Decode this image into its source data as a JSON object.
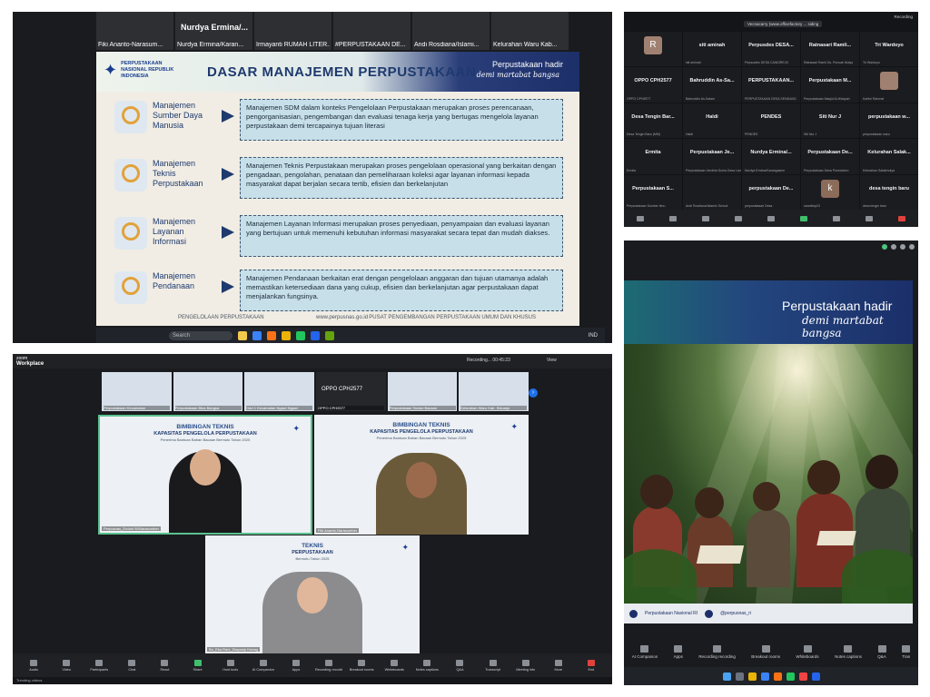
{
  "panel_a": {
    "thumbs": [
      {
        "name": "Fiki Ananto-Narasum...",
        "big": ""
      },
      {
        "name": "Nurdya Ermina/Karan...",
        "big": "Nurdya Ermina/..."
      },
      {
        "name": "Irmayanti RUMAH LITER...",
        "big": ""
      },
      {
        "name": "#PERPUSTAKAAN DE...",
        "big": ""
      },
      {
        "name": "Andi Rosdiana/Islami...",
        "big": ""
      },
      {
        "name": "Kelurahan Waru Kab...",
        "big": ""
      }
    ],
    "slide": {
      "logo_text": "PERPUSTAKAAN NASIONAL REPUBLIK INDONESIA",
      "title": "DASAR MANAJEMEN PERPUSTAKAAN",
      "tagline": "Perpustakaan hadir",
      "tagline2": "demi martabat bangsa",
      "rows": [
        {
          "label": "Manajemen Sumber Daya Manusia",
          "text": "Manajemen SDM dalam konteks Pengelolaan Perpustakaan merupakan proses perencanaan, pengorganisasian, pengembangan dan evaluasi tenaga kerja yang bertugas mengelola layanan perpustakaan demi tercapainya tujuan literasi"
        },
        {
          "label": "Manajemen Teknis Perpustakaan",
          "text": "Manajemen Teknis Perpustakaan merupakan proses pengelolaan operasional yang berkaitan dengan pengadaan, pengolahan, penataan dan pemeliharaan koleksi agar layanan informasi kepada masyarakat dapat berjalan secara tertib, efisien dan berkelanjutan"
        },
        {
          "label": "Manajemen Layanan Informasi",
          "text": "Manajemen Layanan Informasi merupakan proses penyediaan, penyampaian dan evaluasi layanan yang bertujuan untuk memenuhi kebutuhan informasi masyarakat secara tepat dan mudah diakses."
        },
        {
          "label": "Manajemen Pendanaan",
          "text": "Manajemen Pendanaan berkaitan erat dengan pengelolaan anggaran dan tujuan utamanya adalah memastikan ketersediaan dana yang cukup, efisien dan berkelanjutan agar perpustakaan dapat menjalankan fungsinya."
        }
      ],
      "footer_left": "PENGELOLAAN PERPUSTAKAAN",
      "footer_mid": "www.perpusnas.go.id",
      "footer_right": "PUSAT PENGEMBANGAN PERPUSTAKAAN UMUM DAN KHUSUS"
    },
    "taskbar": {
      "search": "Search",
      "tray": "IND"
    }
  },
  "panel_b": {
    "tooltip": "Vecnacarry (www.officefactory ... siding",
    "rec": "Recording",
    "cells": [
      {
        "name": "",
        "sub": "",
        "avatar": "R"
      },
      {
        "name": "siti aminah",
        "sub": "siti aminah"
      },
      {
        "name": "Perpusdes DESA...",
        "sub": "Perpusdes DESA CANDIREJO"
      },
      {
        "name": "Ratnasari Ramli...",
        "sub": "Ratnasari Ramli Ds. Puncak Mulya"
      },
      {
        "name": "Tri Wardoyo",
        "sub": "Tri Wardoyo"
      },
      {
        "name": "OPPO CPH2577",
        "sub": "OPPO CPH2577"
      },
      {
        "name": "Bahruddin As-Sa...",
        "sub": "Bahruddin As-Salam"
      },
      {
        "name": "PERPUSTAKAAN...",
        "sub": "PERPUSTAKAAN DESA SENDANG"
      },
      {
        "name": "Perpustakaan M...",
        "sub": "Perpustakaan Masjid Al-Hidayah"
      },
      {
        "name": "",
        "sub": "Kartini Rahmat",
        "avatar": ""
      },
      {
        "name": "Desa Tengin Bar...",
        "sub": "Desa Tengin Baru (MM)"
      },
      {
        "name": "Haldi",
        "sub": "Haldi"
      },
      {
        "name": "PENDES",
        "sub": "PENDES"
      },
      {
        "name": "Siti Nur J",
        "sub": "Siti Nur J"
      },
      {
        "name": "perpustakaan w...",
        "sub": "perpustakaan waru"
      },
      {
        "name": "Ermita",
        "sub": "Ermita"
      },
      {
        "name": "Perpustakaan Je...",
        "sub": "Perpustakaan Jendela Dunia Desa Lampon"
      },
      {
        "name": "Nurdya Ermina/...",
        "sub": "Nurdya Ermina/Karangasem"
      },
      {
        "name": "Perpustakaan De...",
        "sub": "Perpustakaan Desa Purwotomo"
      },
      {
        "name": "Kelurahan Salak...",
        "sub": "Kelurahan Salakmulya"
      },
      {
        "name": "Perpustakaan S...",
        "sub": "Perpustakaan Sumber Ilmu"
      },
      {
        "name": "",
        "sub": "Andi Rosdiana/Islamic School"
      },
      {
        "name": "perpustakaan De...",
        "sub": "perpustakaan Desa"
      },
      {
        "name": "",
        "sub": "sandelay03",
        "avatar": "k"
      },
      {
        "name": "desa tengin baru",
        "sub": "desa tengin baru"
      }
    ],
    "search": "Search"
  },
  "panel_c": {
    "app_sub": "zoom",
    "app_name": "Workplace",
    "recording": "Recording...",
    "time": "00:45:23",
    "view": "View",
    "strip": [
      {
        "name": "Perpustakaan Kecamatan",
        "big": "",
        "dark": false
      },
      {
        "name": "Perpustakaan Bina Bangsa",
        "big": "",
        "dark": false
      },
      {
        "name": "Hari 1 Kecamatan Ngawi Ngawi",
        "big": "",
        "dark": false
      },
      {
        "name": "OPPO CPH2577",
        "big": "OPPO CPH2577",
        "dark": true
      },
      {
        "name": "Perpustakaan Taman Bacaan",
        "big": "",
        "dark": false
      },
      {
        "name": "Kelurahan Waru Kab. Sidoarjo",
        "big": "",
        "dark": false
      }
    ],
    "tiles": [
      {
        "t1": "BIMBINGAN TEKNIS",
        "t2": "KAPASITAS PENGELOLA PERPUSTAKAAN",
        "t3": "Penerima Bantuan Bahan Bacaan Bermutu Tahun 2025",
        "name": "Perpusnas_Endah W/Narasumber"
      },
      {
        "t1": "BIMBINGAN TEKNIS",
        "t2": "KAPASITAS PENGELOLA PERPUSTAKAAN",
        "t3": "Penerima Bantuan Bahan Bacaan Bermutu Tahun 2025",
        "name": "Fiki Ananto-Narasumber"
      },
      {
        "t1": "TEKNIS",
        "t2": "PERPUSTAKAAN",
        "t3": "Bermutu Tahun 2025",
        "name": "Bu_Eka Rani_Diapusip Kenag"
      }
    ],
    "toolbar": [
      "Audio",
      "Video",
      "Participants",
      "Chat",
      "React",
      "Share",
      "Host tools",
      "AI Companion",
      "Apps",
      "Recording recording",
      "Breakout rooms",
      "Whiteboards",
      "Notes captions",
      "Q&A",
      "Transcript",
      "Meeting info",
      "More",
      "End"
    ],
    "winbar": "Trending videos"
  },
  "panel_d": {
    "banner_line1": "Perpustakaan hadir",
    "banner_line2": "demi martabat bangsa",
    "social1": "Perpustakaan Nasional RI",
    "social2": "@perpusnas_ri",
    "tools": [
      "AI Companion",
      "Apps",
      "Recording recording",
      "Breakout rooms",
      "Whiteboards",
      "Notes captions",
      "Q&A",
      "Tran"
    ]
  }
}
